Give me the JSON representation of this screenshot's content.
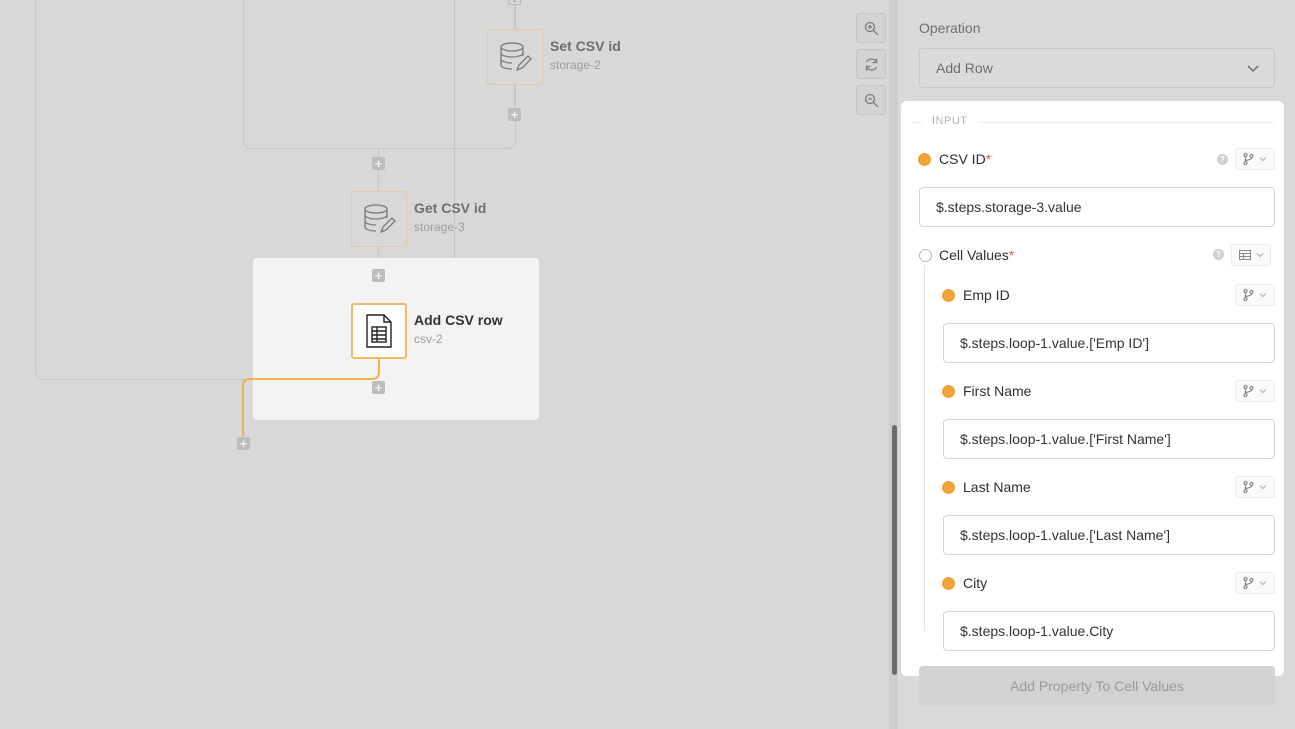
{
  "canvas": {
    "nodes": [
      {
        "title": "Set CSV id",
        "subtitle": "storage-2"
      },
      {
        "title": "Get CSV id",
        "subtitle": "storage-3"
      },
      {
        "title": "Add CSV row",
        "subtitle": "csv-2"
      }
    ],
    "zoom_controls": [
      "zoom-in-icon",
      "reset-icon",
      "zoom-out-icon"
    ]
  },
  "panel": {
    "operation_label": "Operation",
    "operation_value": "Add Row",
    "input_section_label": "INPUT",
    "csv_id": {
      "label": "CSV ID",
      "required": "*",
      "value": "$.steps.storage-3.value"
    },
    "cell_values": {
      "label": "Cell Values",
      "required": "*",
      "fields": [
        {
          "label": "Emp ID",
          "value": "$.steps.loop-1.value.['Emp ID']"
        },
        {
          "label": "First Name",
          "value": "$.steps.loop-1.value.['First Name']"
        },
        {
          "label": "Last Name",
          "value": "$.steps.loop-1.value.['Last Name']"
        },
        {
          "label": "City",
          "value": "$.steps.loop-1.value.City"
        }
      ]
    },
    "add_property_label": "Add Property To Cell Values"
  },
  "colors": {
    "accent": "#f0a33a",
    "required": "#e0574f",
    "overlay": "#d8d8d8"
  }
}
